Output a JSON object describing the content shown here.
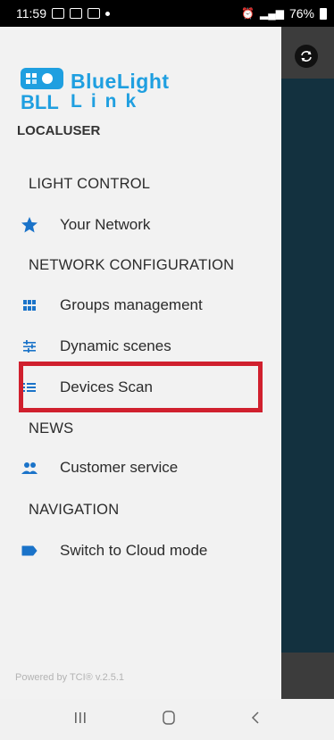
{
  "status_bar": {
    "time": "11:59",
    "battery": "76%"
  },
  "brand": {
    "word1": "BlueLight",
    "word2": "Link",
    "mark_text": "BLL"
  },
  "user": {
    "name": "LOCALUSER"
  },
  "menu": {
    "light_control": {
      "title": "LIGHT CONTROL",
      "items": [
        {
          "label": "Your Network",
          "icon": "star-icon"
        }
      ]
    },
    "network_configuration": {
      "title": "NETWORK CONFIGURATION",
      "items": [
        {
          "label": "Groups management",
          "icon": "grid-icon"
        },
        {
          "label": "Dynamic scenes",
          "icon": "sliders-icon"
        },
        {
          "label": "Devices Scan",
          "icon": "list-icon"
        }
      ]
    },
    "news": {
      "title": "NEWS",
      "items": [
        {
          "label": "Customer service",
          "icon": "people-icon"
        }
      ]
    },
    "navigation": {
      "title": "NAVIGATION",
      "items": [
        {
          "label": "Switch to Cloud mode",
          "icon": "label-icon"
        }
      ]
    }
  },
  "footer": {
    "powered_by": "Powered by TCI® v.2.5.1"
  },
  "colors": {
    "accent": "#1f9fe0",
    "highlight": "#d0202e",
    "overlay": "#13313f"
  }
}
